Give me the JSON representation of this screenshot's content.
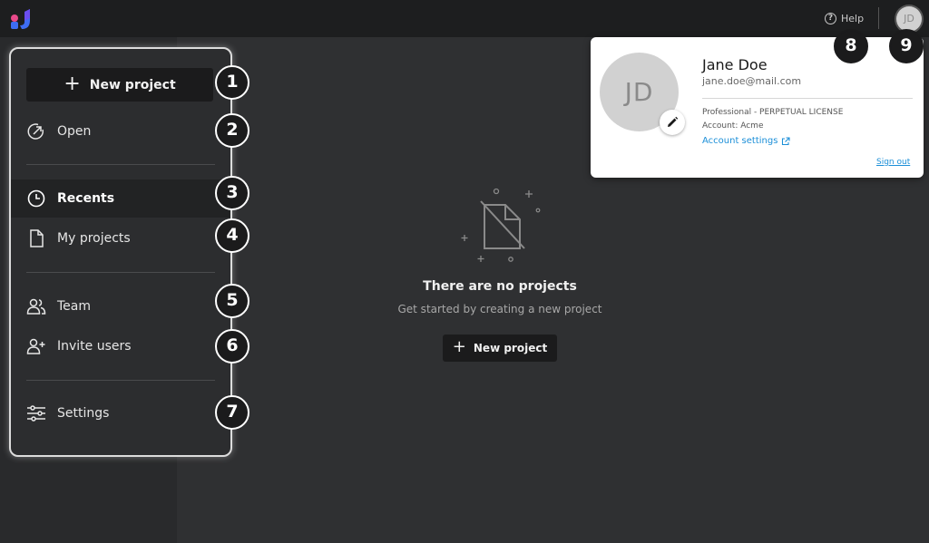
{
  "colors": {
    "topbar_bg": "#1d1e1f",
    "page_bg": "#2f3032",
    "button_bg": "#1b1b1c",
    "link_blue": "#1c8fd8",
    "logo_pink": "#e84a8a",
    "logo_blue": "#3e6df2"
  },
  "topbar": {
    "logo_icon": "app-logo",
    "help_icon": "help-circle-icon",
    "help_label": "Help",
    "avatar_initials": "JD"
  },
  "sidebar": {
    "new_project_label": "New project",
    "items": [
      {
        "label": "Open",
        "icon": "open-arrow-icon"
      },
      {
        "label": "Recents",
        "icon": "clock-icon"
      },
      {
        "label": "My projects",
        "icon": "document-icon"
      },
      {
        "label": "Team",
        "icon": "team-icon"
      },
      {
        "label": "Invite users",
        "icon": "add-user-icon"
      },
      {
        "label": "Settings",
        "icon": "sliders-icon"
      }
    ]
  },
  "badges": [
    "1",
    "2",
    "3",
    "4",
    "5",
    "6",
    "7",
    "8",
    "9"
  ],
  "empty_state": {
    "icon": "no-document-icon",
    "title": "There are no projects",
    "subtitle": "Get started by creating a new project",
    "button_label": "New project"
  },
  "profile": {
    "initials": "JD",
    "name": "Jane Doe",
    "email": "jane.doe@mail.com",
    "plan": "Professional - PERPETUAL LICENSE",
    "account": "Account: Acme",
    "settings_link": "Account settings",
    "sign_out": "Sign out"
  }
}
